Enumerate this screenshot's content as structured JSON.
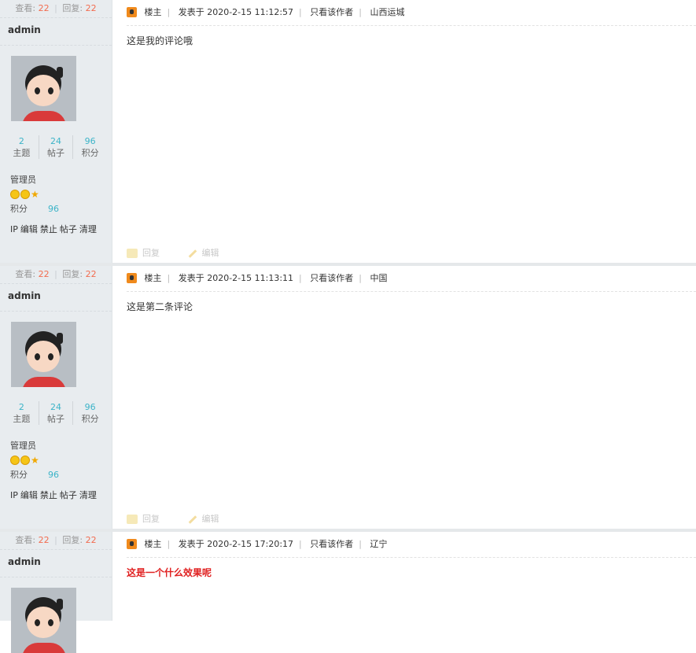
{
  "posts": [
    {
      "stats": {
        "view_label": "查看:",
        "views": "22",
        "reply_label": "回复:",
        "replies": "22"
      },
      "author": "admin",
      "counts": [
        {
          "v": "2",
          "k": "主题"
        },
        {
          "v": "24",
          "k": "帖子"
        },
        {
          "v": "96",
          "k": "积分"
        }
      ],
      "role": "管理员",
      "score_label": "积分",
      "score": "96",
      "admin_links": [
        "IP",
        "编辑",
        "禁止",
        "帖子",
        "清理"
      ],
      "louzhu": "楼主",
      "posted": "发表于 2020-2-15 11:12:57",
      "only_author": "只看该作者",
      "location": "山西运城",
      "content": "这是我的评论哦",
      "content_style": "normal",
      "reply_label": "回复",
      "edit_label": "编辑"
    },
    {
      "stats": {
        "view_label": "查看:",
        "views": "22",
        "reply_label": "回复:",
        "replies": "22"
      },
      "author": "admin",
      "counts": [
        {
          "v": "2",
          "k": "主题"
        },
        {
          "v": "24",
          "k": "帖子"
        },
        {
          "v": "96",
          "k": "积分"
        }
      ],
      "role": "管理员",
      "score_label": "积分",
      "score": "96",
      "admin_links": [
        "IP",
        "编辑",
        "禁止",
        "帖子",
        "清理"
      ],
      "louzhu": "楼主",
      "posted": "发表于 2020-2-15 11:13:11",
      "only_author": "只看该作者",
      "location": "中国",
      "content": "这是第二条评论",
      "content_style": "normal",
      "reply_label": "回复",
      "edit_label": "编辑"
    },
    {
      "stats": {
        "view_label": "查看:",
        "views": "22",
        "reply_label": "回复:",
        "replies": "22"
      },
      "author": "admin",
      "louzhu": "楼主",
      "posted": "发表于 2020-2-15 17:20:17",
      "only_author": "只看该作者",
      "location": "辽宁",
      "content": "这是一个什么效果呢",
      "content_style": "red-bold"
    }
  ],
  "colors": {
    "accent_red": "#f26c4f",
    "count_teal": "#3cb4c8",
    "content_red": "#e02020",
    "left_bg": "#e8ecef"
  }
}
